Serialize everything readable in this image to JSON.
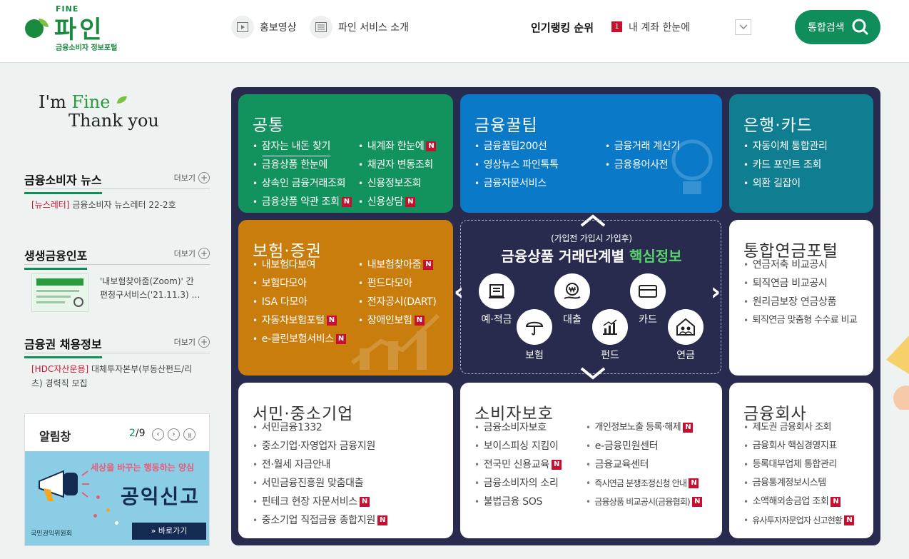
{
  "header": {
    "logo_top": "FINE",
    "logo_title": "파인",
    "logo_sub": "금융소비자 정보포털",
    "nav": [
      {
        "label": "홍보영상",
        "icon": "play-icon"
      },
      {
        "label": "파인 서비스 소개",
        "icon": "list-icon"
      }
    ],
    "ranking_label": "인기랭킹 순위",
    "ranking_num": "1",
    "ranking_text": "내 계좌 한눈에",
    "search_label": "통합검색",
    "accent": "#0f8d5b"
  },
  "left": {
    "slogan_1a": "I'm ",
    "slogan_1b": "Fine",
    "slogan_2": "Thank you",
    "news": {
      "title": "금융소비자 뉴스",
      "more": "더보기",
      "tag": "[뉴스레터]",
      "text": "금융소비자 뉴스레터 22-2호"
    },
    "info": {
      "title": "생생금융인포",
      "more": "더보기",
      "text1": "'내보험찾아줌(Zoom)' 간",
      "text2": "편청구서비스('21.11.3) …"
    },
    "jobs": {
      "title": "금융권 채용정보",
      "more": "더보기",
      "tag": "[HDC자산운용]",
      "text1": " 대체투자본부(부동산펀드/리",
      "text2": "츠) 경력직 모집"
    },
    "alarm": {
      "title": "알림창",
      "current": "2",
      "total": "/9",
      "banner_line1": "세상을 바꾸는 행동하는 양심",
      "banner_line2": "공익신고",
      "banner_button": "» 바로가기",
      "banner_org": "국민권익위원회"
    }
  },
  "board": {
    "common": {
      "title": "공통",
      "col1": [
        "잠자는 내돈 찾기",
        "금융상품 한눈에",
        "상속인 금융거래조회",
        "금융상품 약관 조회"
      ],
      "col2": [
        "내계좌 한눈에",
        "채권자 변동조회",
        "신용정보조회",
        "신용상담"
      ]
    },
    "tips": {
      "title": "금융꿀팁",
      "col1": [
        "금융꿀팁200선",
        "영상뉴스 파인톡톡",
        "금융자문서비스"
      ],
      "col2": [
        "금융거래 계산기",
        "금융용어사전"
      ]
    },
    "bank": {
      "title": "은행·카드",
      "items": [
        "자동이체 통합관리",
        "카드 포인트 조회",
        "외환 길잡이"
      ]
    },
    "insurance": {
      "title": "보험·증권",
      "col1": [
        "내보험다보여",
        "보험다모아",
        "ISA 다모아",
        "자동차보험포털",
        "e-클린보험서비스"
      ],
      "col2": [
        "내보험찾아줌",
        "펀드다모아",
        "전자공시(DART)",
        "장애인보험"
      ]
    },
    "center": {
      "sub": "(가입전 가입시 가입후)",
      "main": "금융상품 거래단계별 ",
      "main_hl": "핵심정보",
      "items": [
        "예·적금",
        "대출",
        "카드",
        "보험",
        "펀드",
        "연금"
      ]
    },
    "pension": {
      "title": "통합연금포털",
      "items": [
        "연금저축 비교공시",
        "퇴직연금 비교공시",
        "원리금보장 연금상품",
        "퇴직연금 맞춤형 수수료 비교"
      ]
    },
    "sme": {
      "title": "서민·중소기업",
      "items": [
        "서민금융1332",
        "중소기업·자영업자 금융지원",
        "전·월세 자금안내",
        "서민금융진흥원 맞춤대출",
        "핀테크 현장 자문서비스",
        "중소기업 직접금융 종합지원"
      ]
    },
    "protect": {
      "title": "소비자보호",
      "col1": [
        "금융소비자보호",
        "보이스피싱 지킴이",
        "전국민 신용교육",
        "금융소비자의 소리",
        "불법금융 SOS"
      ],
      "col2": [
        "개인정보노출 등록·해제",
        "e-금융민원센터",
        "금융교육센터",
        "즉시연금 분쟁조정신청 안내",
        "금융상품 비교공시(금융협회)"
      ]
    },
    "companies": {
      "title": "금융회사",
      "items": [
        "제도권 금융회사 조회",
        "금융회사 핵심경영지표",
        "등록대부업체 통합관리",
        "금융통계정보시스템",
        "소액해외송금업 조회",
        "유사투자자문업자 신고현황"
      ]
    },
    "new_badge": "N"
  }
}
